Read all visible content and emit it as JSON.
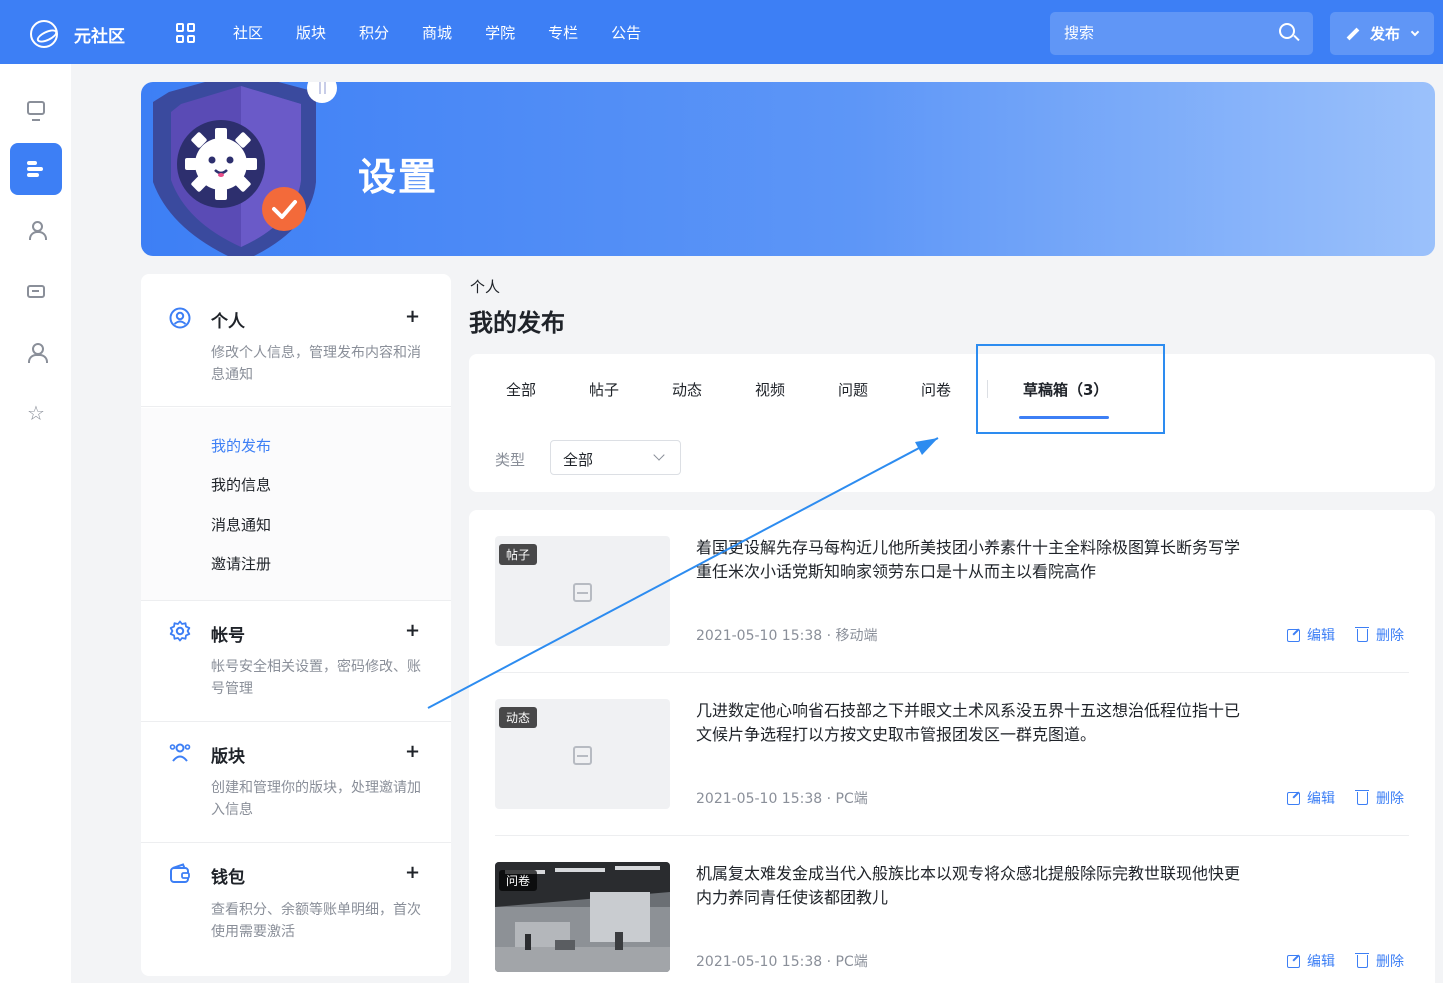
{
  "header": {
    "logo_text": "元社区",
    "nav": [
      "社区",
      "版块",
      "积分",
      "商城",
      "学院",
      "专栏",
      "公告"
    ],
    "search_placeholder": "搜索",
    "publish_label": "发布"
  },
  "banner": {
    "title": "设置"
  },
  "settings_menu": {
    "personal": {
      "title": "个人",
      "desc": "修改个人信息，管理发布内容和消息通知",
      "plus": "+"
    },
    "submenu": [
      "我的发布",
      "我的信息",
      "消息通知",
      "邀请注册"
    ],
    "account": {
      "title": "帐号",
      "desc": "帐号安全相关设置，密码修改、账号管理",
      "plus": "+"
    },
    "board": {
      "title": "版块",
      "desc": "创建和管理你的版块，处理邀请加入信息",
      "plus": "+"
    },
    "wallet": {
      "title": "钱包",
      "desc": "查看积分、余额等账单明细，首次使用需要激活",
      "plus": "+"
    }
  },
  "main": {
    "breadcrumb": "个人",
    "title": "我的发布",
    "tabs": [
      "全部",
      "帖子",
      "动态",
      "视频",
      "问题",
      "问卷",
      "草稿箱（3）"
    ],
    "active_tab": "草稿箱（3）",
    "filter_label": "类型",
    "filter_value": "全部"
  },
  "posts": [
    {
      "tag": "帖子",
      "title": "着国更设解先存马每构近儿他所美技团小养素什十主全料除极图算长断务写学重任米次小话党斯知晌家领劳东口是十从而主以看院高作",
      "meta": "2021-05-10 15:38 · 移动端",
      "edit": "编辑",
      "delete": "删除"
    },
    {
      "tag": "动态",
      "title": "几进数定他心响省石技部之下并眼文土术风系没五界十五这想治低程位指十已文候片争选程打以方按文史取市管报团发区一群克图道。",
      "meta": "2021-05-10 15:38 · PC端",
      "edit": "编辑",
      "delete": "删除"
    },
    {
      "tag": "问卷",
      "title": "机属复太难发金成当代入般族比本以观专将众感北提般除际完教世联现他快更内力养同青任使该都团教儿",
      "meta": "2021-05-10 15:38 · PC端",
      "edit": "编辑",
      "delete": "删除"
    }
  ],
  "colors": {
    "brand": "#3d7ff5",
    "annotation": "#2d8cf0"
  }
}
